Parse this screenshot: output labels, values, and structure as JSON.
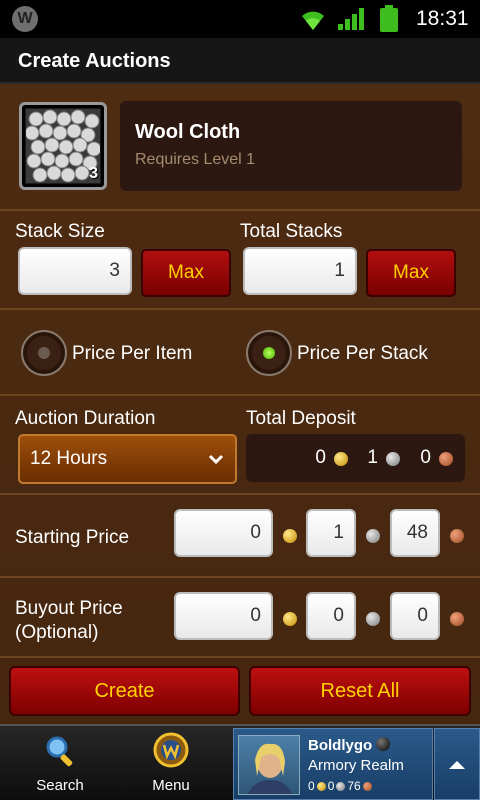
{
  "status_bar": {
    "app_letter": "W",
    "time": "18:31"
  },
  "title": "Create Auctions",
  "item": {
    "name": "Wool Cloth",
    "requirement": "Requires Level 1",
    "count": "3"
  },
  "stack": {
    "stack_size_label": "Stack Size",
    "stack_size_value": "3",
    "stack_max_label": "Max",
    "total_stacks_label": "Total Stacks",
    "total_stacks_value": "1",
    "total_max_label": "Max"
  },
  "pricing_mode": {
    "per_item_label": "Price Per Item",
    "per_stack_label": "Price Per Stack",
    "selected": "Price Per Stack"
  },
  "duration": {
    "label": "Auction Duration",
    "value": "12 Hours"
  },
  "deposit": {
    "label": "Total Deposit",
    "gold": "0",
    "silver": "1",
    "copper": "0"
  },
  "starting_price": {
    "label": "Starting Price",
    "gold": "0",
    "silver": "1",
    "copper": "48"
  },
  "buyout_price": {
    "label": "Buyout Price (Optional)",
    "label_line1": "Buyout Price",
    "label_line2": "(Optional)",
    "gold": "0",
    "silver": "0",
    "copper": "0"
  },
  "actions": {
    "create_label": "Create",
    "reset_label": "Reset All"
  },
  "bottom_nav": {
    "search_label": "Search",
    "menu_label": "Menu",
    "character": {
      "name": "Boldlygo",
      "realm": "Armory Realm",
      "gold": "0",
      "silver": "0",
      "copper": "76"
    }
  },
  "colors": {
    "accent_gold": "#ffd200",
    "button_red": "#b10f0f",
    "panel_brown": "#4e2c12",
    "radio_selected": "#44b000"
  },
  "icons": [
    "wifi-icon",
    "signal-icon",
    "battery-icon",
    "search-icon",
    "wow-menu-icon",
    "chevron-down-icon",
    "arrow-up-icon",
    "gold-coin-icon",
    "silver-coin-icon",
    "copper-coin-icon"
  ]
}
